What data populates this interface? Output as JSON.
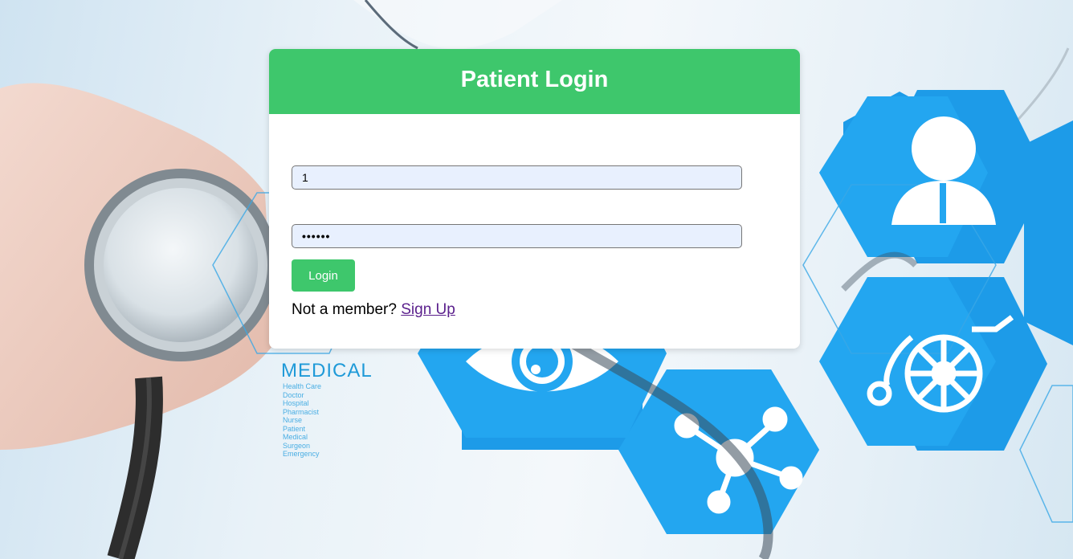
{
  "page": {
    "title": "Patient Login"
  },
  "login_form": {
    "username_value": "1",
    "password_value": "••••••",
    "login_button": "Login",
    "signup_prompt": "Not a member?",
    "signup_link": "Sign Up"
  },
  "background": {
    "medical_word": "MEDICAL",
    "medical_terms": [
      "Health Care",
      "Doctor",
      "Hospital",
      "Pharmacist",
      "Nurse",
      "Patient",
      "Medical",
      "Surgeon",
      "Emergency"
    ],
    "icons": [
      "stethoscope-icon",
      "person-icon",
      "eye-icon",
      "wheelchair-icon",
      "molecule-icon"
    ],
    "accent_color": "#2a9fe6"
  },
  "colors": {
    "brand_green": "#3ec76c",
    "input_bg": "#e8f0fe",
    "link_purple": "#5a1f8c"
  }
}
